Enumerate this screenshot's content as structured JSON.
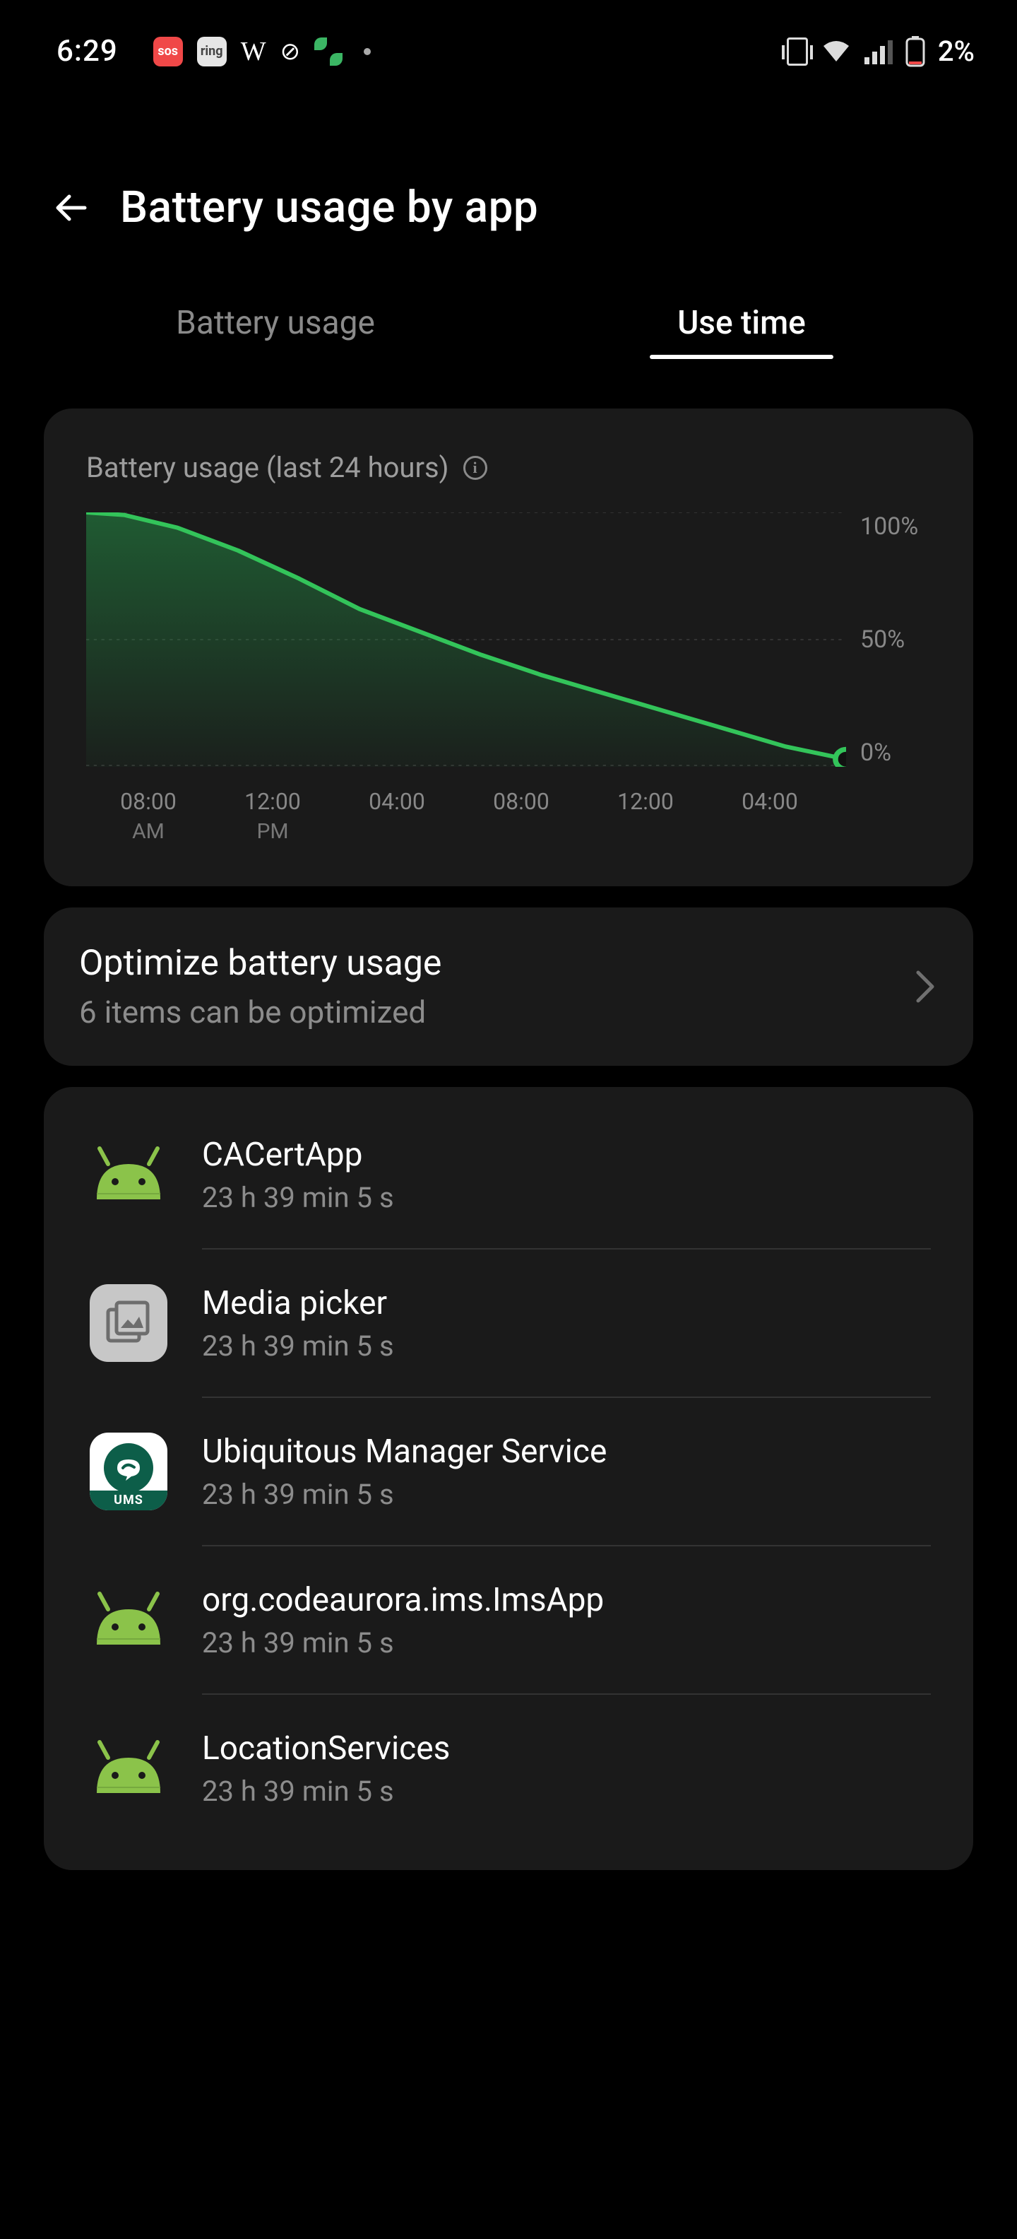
{
  "status": {
    "time": "6:29",
    "battery_pct": "2%"
  },
  "header": {
    "title": "Battery usage by app"
  },
  "tabs": {
    "battery_usage": "Battery usage",
    "use_time": "Use time"
  },
  "chart": {
    "title": "Battery usage (last 24 hours)"
  },
  "chart_data": {
    "type": "area",
    "title": "Battery usage (last 24 hours)",
    "xlabel": "",
    "ylabel": "",
    "ylim": [
      0,
      100
    ],
    "y_ticks": [
      "100%",
      "50%",
      "0%"
    ],
    "x_ticks": [
      {
        "label": "08:00",
        "sub": "AM"
      },
      {
        "label": "12:00",
        "sub": "PM"
      },
      {
        "label": "04:00",
        "sub": ""
      },
      {
        "label": "08:00",
        "sub": ""
      },
      {
        "label": "12:00",
        "sub": ""
      },
      {
        "label": "04:00",
        "sub": ""
      }
    ],
    "x": [
      0,
      0.05,
      0.12,
      0.2,
      0.28,
      0.36,
      0.44,
      0.52,
      0.6,
      0.68,
      0.76,
      0.84,
      0.92,
      1.0
    ],
    "values": [
      100,
      99,
      94,
      85,
      74,
      62,
      53,
      44,
      36,
      29,
      22,
      15,
      8,
      3
    ],
    "series_color": "#33b64c",
    "end_marker": true
  },
  "optimize": {
    "title": "Optimize battery usage",
    "subtitle": "6 items can be optimized"
  },
  "apps": [
    {
      "name": "CACertApp",
      "time": "23 h 39 min 5 s",
      "icon": "android"
    },
    {
      "name": "Media picker",
      "time": "23 h 39 min 5 s",
      "icon": "media"
    },
    {
      "name": "Ubiquitous Manager Service",
      "time": "23 h 39 min 5 s",
      "icon": "ums"
    },
    {
      "name": "org.codeaurora.ims.ImsApp",
      "time": "23 h 39 min 5 s",
      "icon": "android"
    },
    {
      "name": "LocationServices",
      "time": "23 h 39 min 5 s",
      "icon": "android"
    }
  ],
  "ums_label": "UMS"
}
